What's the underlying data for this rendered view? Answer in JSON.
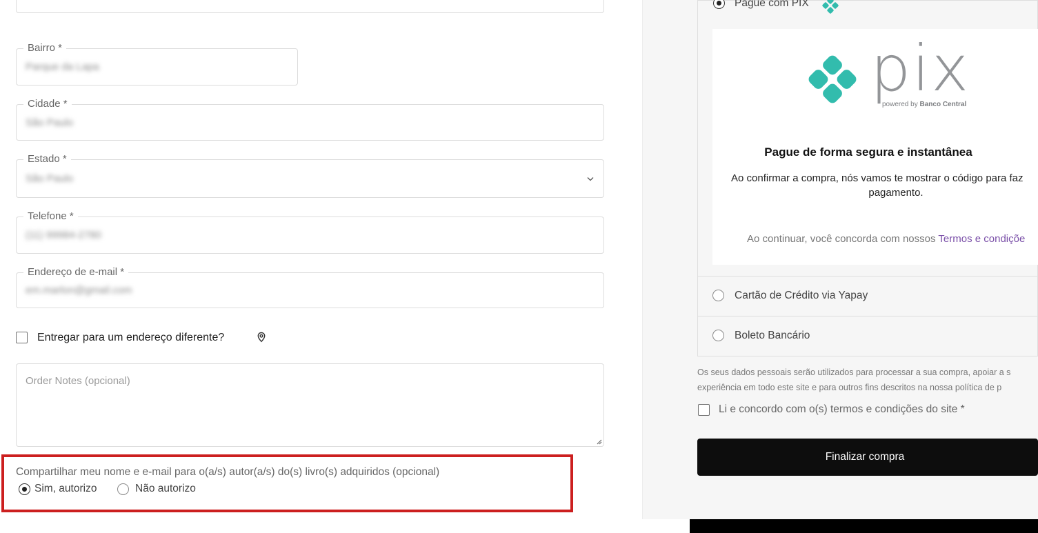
{
  "form": {
    "top_field_value": "",
    "fields": {
      "bairro": {
        "label": "Bairro *",
        "value": "Parque da Lapa"
      },
      "cidade": {
        "label": "Cidade *",
        "value": "São Paulo"
      },
      "estado": {
        "label": "Estado *",
        "value": "São Paulo"
      },
      "telefone": {
        "label": "Telefone *",
        "value": "(11) 99984-2780"
      },
      "email": {
        "label": "Endereço de e-mail *",
        "value": "em.marlon@gmail.com"
      }
    },
    "ship_different_label": "Entregar para um endereço diferente?",
    "order_notes_placeholder": "Order Notes (opcional)",
    "consent": {
      "question": "Compartilhar meu nome e e-mail para o(a/s) autor(a/s) do(s) livro(s) adquiridos (opcional)",
      "options": [
        {
          "label": "Sim, autorizo",
          "selected": true
        },
        {
          "label": "Não autorizo",
          "selected": false
        }
      ]
    }
  },
  "payment": {
    "options": [
      {
        "label": "Pague com PIX",
        "selected": true
      },
      {
        "label": "Cartão de Crédito via Yapay",
        "selected": false
      },
      {
        "label": "Boleto Bancário",
        "selected": false
      }
    ],
    "pix": {
      "logo_text": "pix",
      "powered_by": "powered by",
      "powered_by_bank": "Banco Central",
      "title": "Pague de forma segura e instantânea",
      "text_line1": "Ao confirmar a compra, nós vamos te mostrar o código para faz",
      "text_line2": "pagamento.",
      "terms_prefix": "Ao continuar, você concorda com nossos",
      "terms_link": "Termos e condiçõe"
    },
    "privacy_line1": "Os seus dados pessoais serão utilizados para processar a sua compra, apoiar a s",
    "privacy_line2": "experiência em todo este site e para outros fins descritos na nossa política de p",
    "terms_checkbox_label": "Li e concordo com o(s) termos e condições do site *",
    "finalize_button": "Finalizar compra"
  },
  "colors": {
    "pix_teal": "#32bcad",
    "pix_gray": "#939598",
    "highlight_red": "#cc1f1f",
    "link_purple": "#7a4fa8",
    "button_black": "#0d0d0d"
  }
}
